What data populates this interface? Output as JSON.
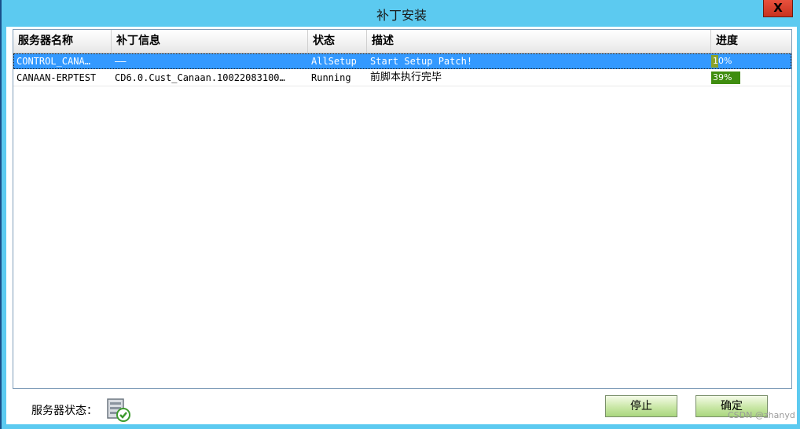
{
  "window": {
    "title": "补丁安装",
    "close_label": "X"
  },
  "grid": {
    "columns": [
      "服务器名称",
      "补丁信息",
      "状态",
      "描述",
      "进度"
    ],
    "rows": [
      {
        "server": "CONTROL_CANA…",
        "patch": "——",
        "status": "AllSetup",
        "desc": "Start Setup Patch!",
        "progress_text": "10%",
        "progress": 0.1,
        "selected": true
      },
      {
        "server": "CANAAN-ERPTEST",
        "patch": "CD6.0.Cust_Canaan.10022083100…",
        "status": "Running",
        "desc": "前脚本执行完毕",
        "progress_text": "39%",
        "progress": 0.39,
        "selected": false
      }
    ]
  },
  "footer": {
    "status_label": "服务器状态：",
    "stop_label": "停止",
    "ok_label": "确定",
    "watermark": "CSDN @zhanyd"
  },
  "colors": {
    "titlebar": "#5ccaf0",
    "selection": "#3399ff",
    "progress_selected": "#8aa22a",
    "progress_normal": "#3f8d0f",
    "close": "#d8442e"
  }
}
